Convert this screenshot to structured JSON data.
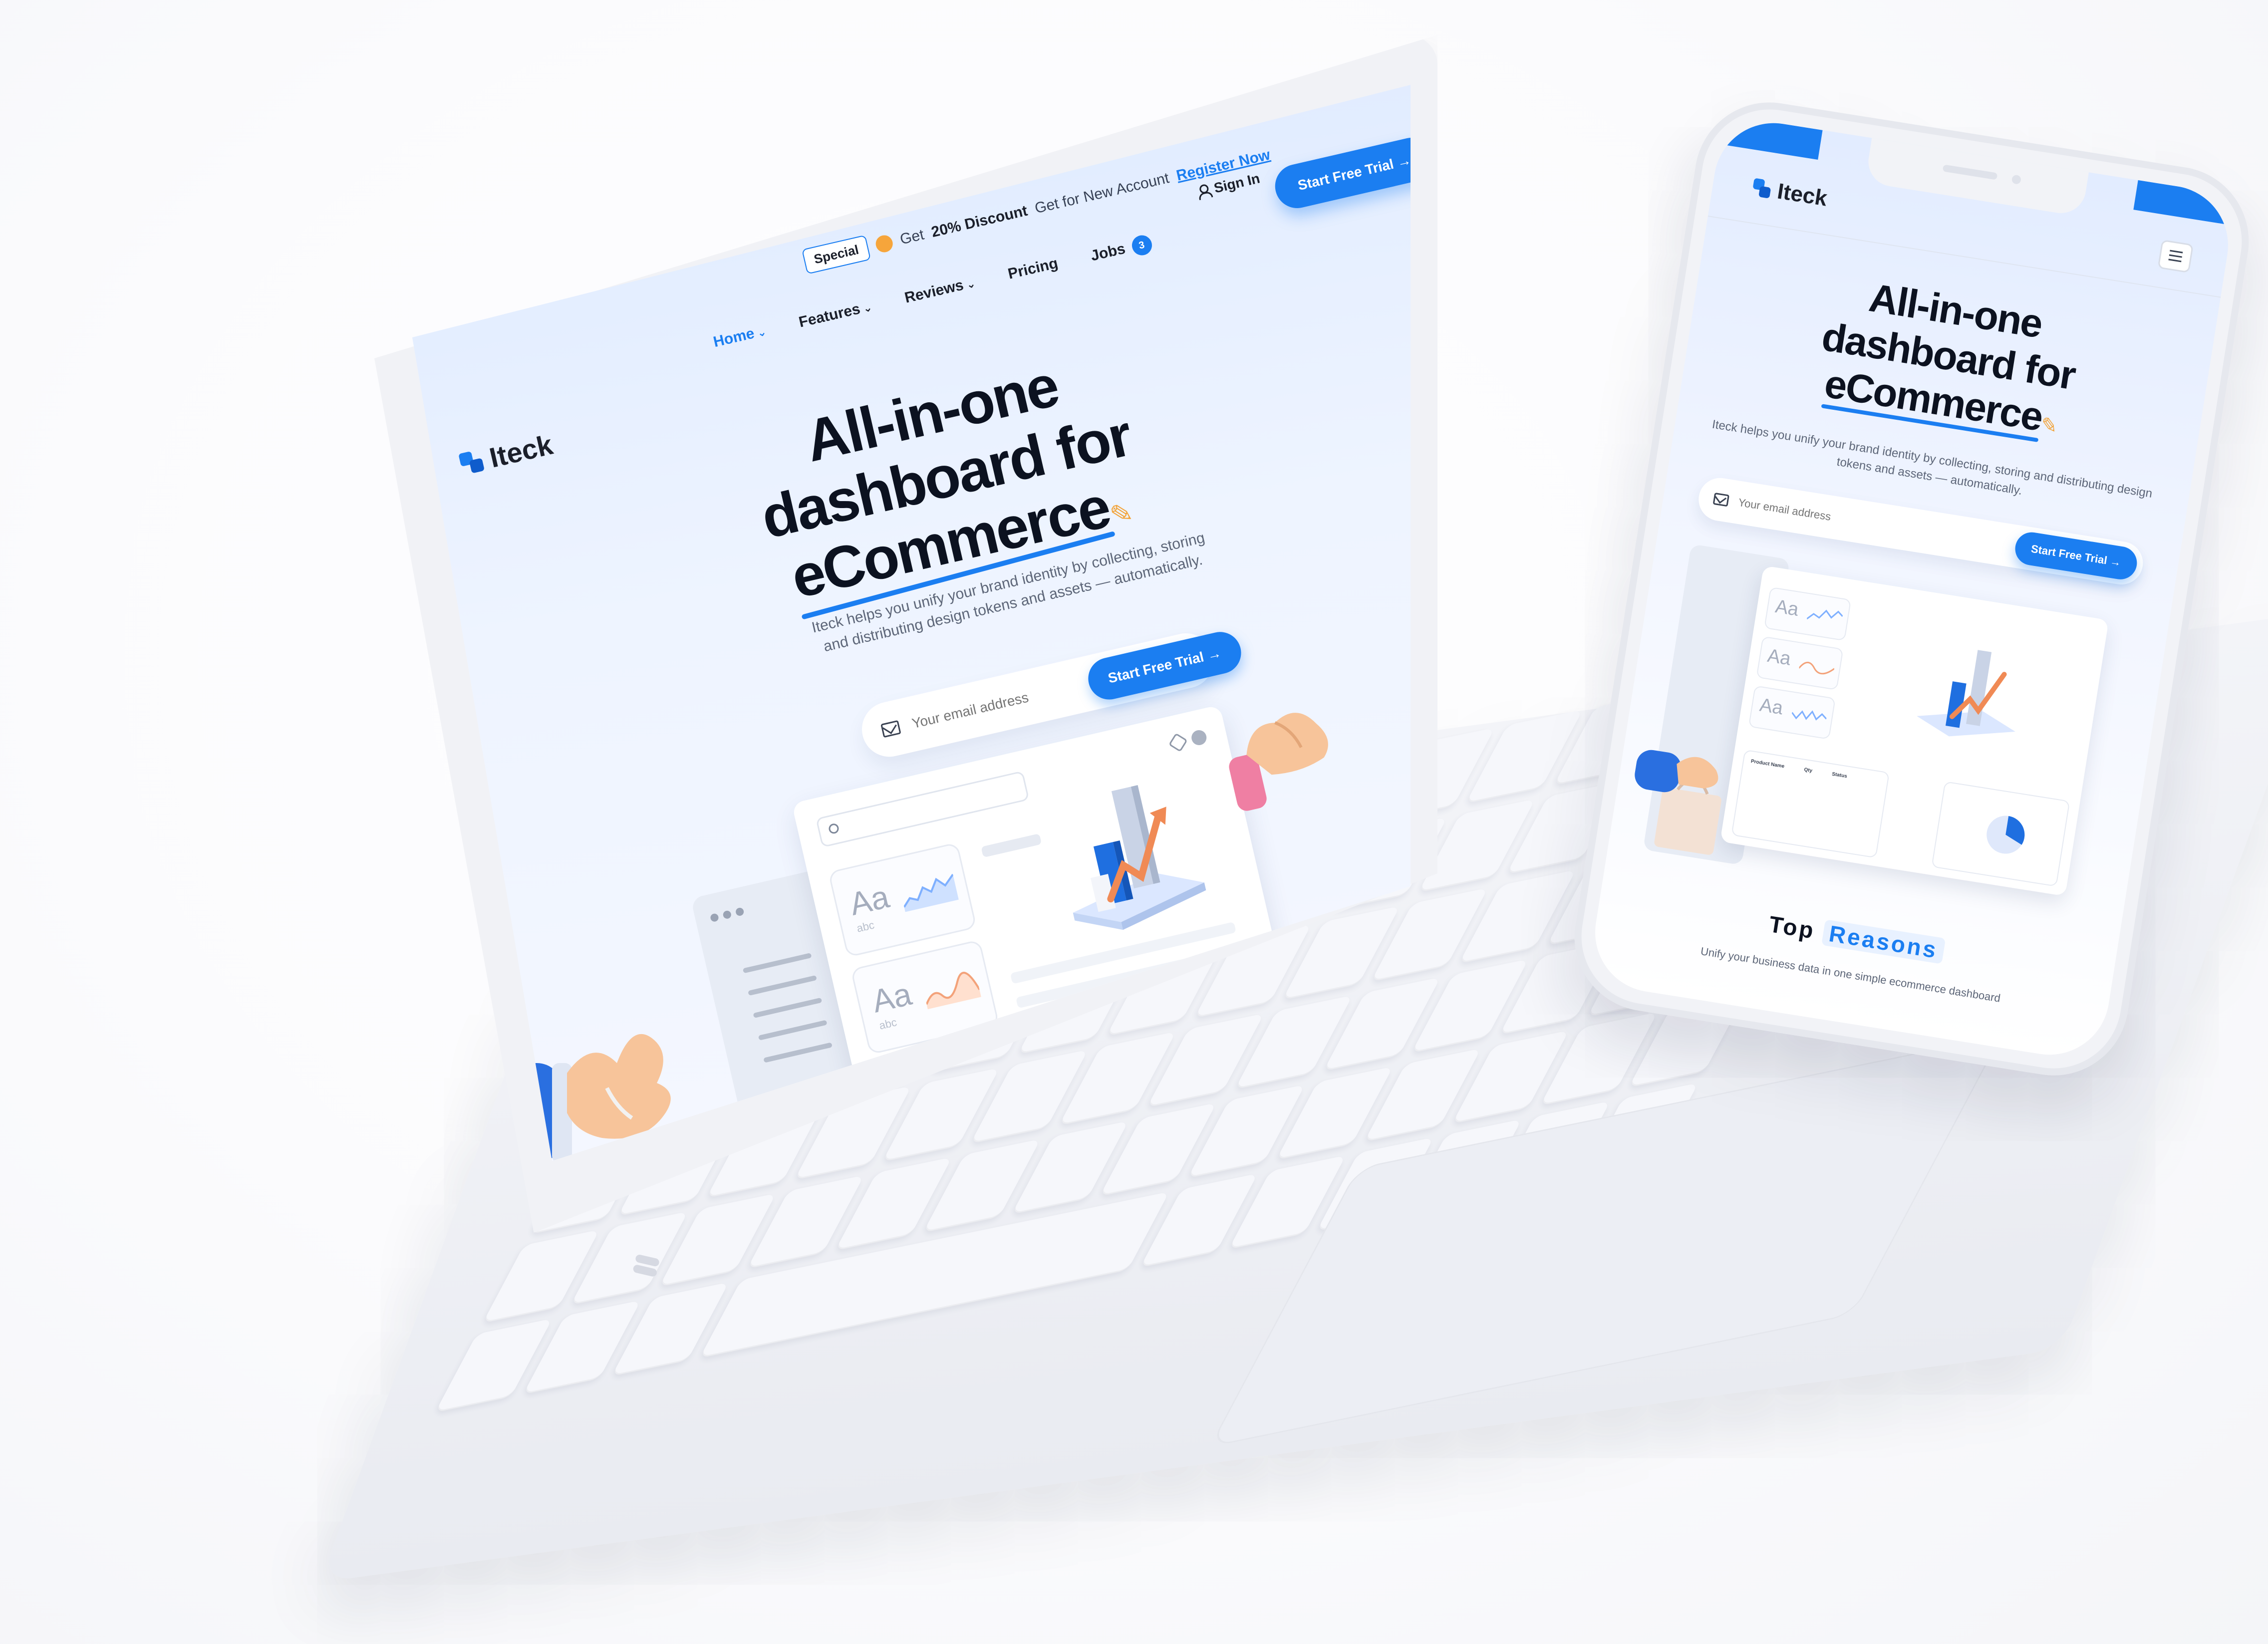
{
  "brand": {
    "name": "Iteck",
    "accent": "#1b7ef1"
  },
  "promo": {
    "badge": "Special",
    "prefix": "Get",
    "discount": "20% Discount",
    "suffix": "Get for New Account",
    "link": "Register Now"
  },
  "header": {
    "signin": "Sign In",
    "trial_button": "Start Free Trial",
    "nav": [
      {
        "label": "Home"
      },
      {
        "label": "Features"
      },
      {
        "label": "Reviews"
      },
      {
        "label": "Pricing"
      },
      {
        "label": "Jobs",
        "badge": "3"
      }
    ]
  },
  "hero": {
    "title_line1": "All-in-one dashboard for",
    "title_line2": "eCommerce",
    "subtitle": "Iteck helps you unify your brand identity by collecting, storing and distributing design tokens and assets — automatically.",
    "email_placeholder": "Your email address",
    "cta": "Start Free Trial"
  },
  "dashboard": {
    "card_label": "Aa",
    "card_sub": "abc"
  },
  "mobile": {
    "title_line1": "All-in-one",
    "title_line2": "dashboard for",
    "title_line3": "eCommerce",
    "subtitle": "Iteck helps you unify your brand identity by collecting, storing and distributing design tokens and assets — automatically.",
    "email_placeholder": "Your email address",
    "cta": "Start Free Trial",
    "table_headers": [
      "Product Name",
      "Qty",
      "Status"
    ],
    "section_title_a": "Top",
    "section_title_b": "Reasons",
    "section_sub": "Unify your business data in one simple ecommerce dashboard"
  }
}
